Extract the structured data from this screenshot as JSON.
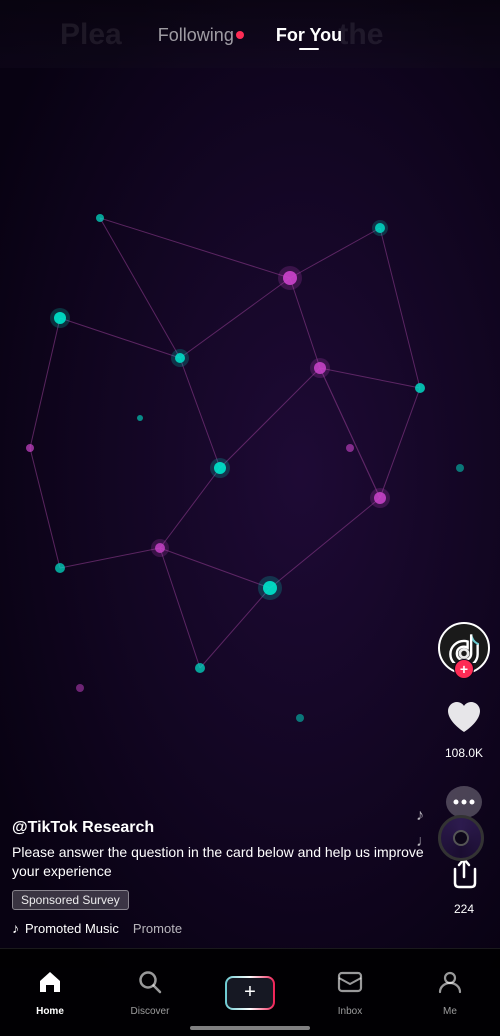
{
  "header": {
    "ghost_text": "Plea",
    "following_label": "Following",
    "for_you_label": "For You",
    "ghost_right": "the"
  },
  "actions": {
    "likes": "108.0K",
    "shares": "224",
    "avatar_plus": "+"
  },
  "content": {
    "username": "@TikTok Research",
    "description": "Please answer the question in the card below and help us improve your experience",
    "sponsored_label": "Sponsored Survey",
    "music_note": "♪",
    "music_name": "Promoted Music",
    "promoted_label": "Promote"
  },
  "bottom_nav": {
    "home": "Home",
    "discover": "Discover",
    "inbox": "Inbox",
    "me": "Me"
  },
  "icons": {
    "home": "⌂",
    "search": "🔍",
    "inbox": "💬",
    "profile": "👤",
    "music_note": "♪",
    "heart": "♥",
    "comment": "···",
    "share": "↷"
  }
}
